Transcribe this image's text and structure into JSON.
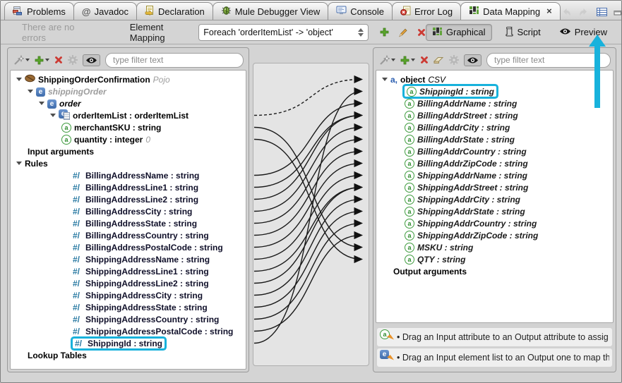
{
  "colors": {
    "accent": "#18b2dc",
    "curve": "#1a1a1a",
    "rule_prefix": "#2879a2"
  },
  "tabs": [
    {
      "label": "Problems",
      "icon": "problems-icon"
    },
    {
      "label": "Javadoc",
      "icon": "at-icon"
    },
    {
      "label": "Declaration",
      "icon": "declaration-icon"
    },
    {
      "label": "Mule Debugger View",
      "icon": "debugger-icon"
    },
    {
      "label": "Console",
      "icon": "console-icon"
    },
    {
      "label": "Error Log",
      "icon": "error-log-icon"
    },
    {
      "label": "Data Mapping",
      "icon": "data-mapping-icon",
      "active": true,
      "close": "×"
    }
  ],
  "window_controls": [
    {
      "name": "nav-back",
      "icon": "nav-back-icon"
    },
    {
      "name": "nav-forward",
      "icon": "nav-forward-icon"
    },
    {
      "name": "view-menu",
      "icon": "view-menu-icon"
    },
    {
      "name": "minimize",
      "icon": "minimize-icon"
    },
    {
      "name": "maximize",
      "icon": "maximize-icon"
    }
  ],
  "toolbar": {
    "status_text": "There are no errors",
    "mapping_label": "Element Mapping",
    "dropdown_value": "Foreach 'orderItemList' -> 'object'",
    "actions": [
      {
        "icon": "add-icon"
      },
      {
        "icon": "pencil-icon"
      },
      {
        "icon": "delete-icon"
      }
    ],
    "view_buttons": [
      {
        "label": "Graphical",
        "icon": "data-mapping-icon",
        "active": true
      },
      {
        "label": "Script",
        "icon": "script-icon",
        "active": false
      },
      {
        "label": "Preview",
        "icon": "eye-icon",
        "active": false
      }
    ]
  },
  "left_panel": {
    "filter_placeholder": "type filter text",
    "toolbar": [
      {
        "icon": "wand-icon",
        "dropdown": true
      },
      {
        "icon": "add-icon",
        "dropdown": true
      },
      {
        "icon": "delete-icon"
      },
      {
        "icon": "gear-icon"
      },
      {
        "icon": "eye-icon",
        "pressed": true
      }
    ],
    "tree": [
      {
        "id": "ShippingOrderConfirmation",
        "label": "ShippingOrderConfirmation",
        "suffix": " Pojo",
        "icon": "bean-icon",
        "level": 0,
        "arrow": true,
        "label_style": "t-bold",
        "suffix_style": "t-grayit"
      },
      {
        "id": "shippingOrder",
        "label": "shippingOrder",
        "icon": "element-icon",
        "level": 1,
        "arrow": true,
        "label_style": "t-gray"
      },
      {
        "id": "order",
        "label": "order",
        "icon": "element-icon",
        "level": 2,
        "arrow": true,
        "label_style": "t-bolditalic"
      },
      {
        "id": "orderItemList",
        "label": "orderItemList : orderItemList",
        "icon": "element-list-icon",
        "level": 3,
        "arrow": true,
        "label_style": "t-bold"
      },
      {
        "id": "merchantSKU",
        "label": "merchantSKU : string",
        "icon": "attribute-icon",
        "level": 4,
        "label_style": "t-bold"
      },
      {
        "id": "quantity",
        "label": "quantity : integer",
        "suffix": " 0",
        "icon": "attribute-icon",
        "level": 4,
        "label_style": "t-bold",
        "suffix_style": "t-grayit"
      },
      {
        "id": "input-arguments",
        "label": "Input arguments",
        "level": 1,
        "label_style": "t-bold"
      },
      {
        "id": "rules",
        "label": "Rules",
        "level": 0,
        "arrow": true,
        "label_style": "t-bold"
      },
      {
        "id": "rule-BillingAddressName",
        "prefix": "#/",
        "label": "BillingAddressName : string",
        "level": 5,
        "label_style": "rule-label"
      },
      {
        "id": "rule-BillingAddressLine1",
        "prefix": "#/",
        "label": "BillingAddressLine1 : string",
        "level": 5,
        "label_style": "rule-label"
      },
      {
        "id": "rule-BillingAddressLine2",
        "prefix": "#/",
        "label": "BillingAddressLine2 : string",
        "level": 5,
        "label_style": "rule-label"
      },
      {
        "id": "rule-BillingAddressCity",
        "prefix": "#/",
        "label": "BillingAddressCity : string",
        "level": 5,
        "label_style": "rule-label"
      },
      {
        "id": "rule-BillingAddressState",
        "prefix": "#/",
        "label": "BillingAddressState : string",
        "level": 5,
        "label_style": "rule-label"
      },
      {
        "id": "rule-BillingAddressCountry",
        "prefix": "#/",
        "label": "BillingAddressCountry : string",
        "level": 5,
        "label_style": "rule-label"
      },
      {
        "id": "rule-BillingAddressPostalCode",
        "prefix": "#/",
        "label": "BillingAddressPostalCode : string",
        "level": 5,
        "label_style": "rule-label"
      },
      {
        "id": "rule-ShippingAddressName",
        "prefix": "#/",
        "label": "ShippingAddressName : string",
        "level": 5,
        "label_style": "rule-label"
      },
      {
        "id": "rule-ShippingAddressLine1",
        "prefix": "#/",
        "label": "ShippingAddressLine1 : string",
        "level": 5,
        "label_style": "rule-label"
      },
      {
        "id": "rule-ShippingAddressLine2",
        "prefix": "#/",
        "label": "ShippingAddressLine2 : string",
        "level": 5,
        "label_style": "rule-label"
      },
      {
        "id": "rule-ShippingAddressCity",
        "prefix": "#/",
        "label": "ShippingAddressCity : string",
        "level": 5,
        "label_style": "rule-label"
      },
      {
        "id": "rule-ShippingAddressState",
        "prefix": "#/",
        "label": "ShippingAddressState : string",
        "level": 5,
        "label_style": "rule-label"
      },
      {
        "id": "rule-ShippingAddressCountry",
        "prefix": "#/",
        "label": "ShippingAddressCountry : string",
        "level": 5,
        "label_style": "rule-label"
      },
      {
        "id": "rule-ShippingAddressPostalCode",
        "prefix": "#/",
        "label": "ShippingAddressPostalCode : string",
        "level": 5,
        "label_style": "rule-label"
      },
      {
        "id": "rule-ShippingId",
        "prefix": "#/",
        "label": "ShippingId : string",
        "level": 5,
        "label_style": "rule-label",
        "highlight": true
      },
      {
        "id": "lookup-tables",
        "label": "Lookup Tables",
        "level": 1,
        "label_style": "t-bold"
      }
    ]
  },
  "right_panel": {
    "filter_placeholder": "type filter text",
    "toolbar": [
      {
        "icon": "wand-icon",
        "dropdown": true
      },
      {
        "icon": "add-icon",
        "dropdown": true
      },
      {
        "icon": "delete-icon"
      },
      {
        "icon": "eraser-icon"
      },
      {
        "icon": "gear-icon"
      },
      {
        "icon": "eye-icon",
        "pressed": true
      }
    ],
    "tree": [
      {
        "id": "object",
        "label": "object",
        "suffix": " CSV",
        "icon": "csv-icon",
        "level": 0,
        "arrow": true,
        "label_style": "t-bold",
        "suffix_style": "t-italic"
      },
      {
        "id": "ShippingId",
        "label": "ShippingId : string",
        "icon": "attribute-icon",
        "level": 2,
        "label_style": "t-attr",
        "highlight": true
      },
      {
        "id": "BillingAddrName",
        "label": "BillingAddrName : string",
        "icon": "attribute-icon",
        "level": 2,
        "label_style": "t-attr"
      },
      {
        "id": "BillingAddrStreet",
        "label": "BillingAddrStreet : string",
        "icon": "attribute-icon",
        "level": 2,
        "label_style": "t-attr"
      },
      {
        "id": "BillingAddrCity",
        "label": "BillingAddrCity : string",
        "icon": "attribute-icon",
        "level": 2,
        "label_style": "t-attr"
      },
      {
        "id": "BillingAddrState",
        "label": "BillingAddrState : string",
        "icon": "attribute-icon",
        "level": 2,
        "label_style": "t-attr"
      },
      {
        "id": "BillingAddrCountry",
        "label": "BillingAddrCountry : string",
        "icon": "attribute-icon",
        "level": 2,
        "label_style": "t-attr"
      },
      {
        "id": "BillingAddrZipCode",
        "label": "BillingAddrZipCode : string",
        "icon": "attribute-icon",
        "level": 2,
        "label_style": "t-attr"
      },
      {
        "id": "ShippingAddrName",
        "label": "ShippingAddrName : string",
        "icon": "attribute-icon",
        "level": 2,
        "label_style": "t-attr"
      },
      {
        "id": "ShippingAddrStreet",
        "label": "ShippingAddrStreet : string",
        "icon": "attribute-icon",
        "level": 2,
        "label_style": "t-attr"
      },
      {
        "id": "ShippingAddrCity",
        "label": "ShippingAddrCity : string",
        "icon": "attribute-icon",
        "level": 2,
        "label_style": "t-attr"
      },
      {
        "id": "ShippingAddrState",
        "label": "ShippingAddrState : string",
        "icon": "attribute-icon",
        "level": 2,
        "label_style": "t-attr"
      },
      {
        "id": "ShippingAddrCountry",
        "label": "ShippingAddrCountry : string",
        "icon": "attribute-icon",
        "level": 2,
        "label_style": "t-attr"
      },
      {
        "id": "ShippingAddrZipCode",
        "label": "ShippingAddrZipCode : string",
        "icon": "attribute-icon",
        "level": 2,
        "label_style": "t-attr"
      },
      {
        "id": "MSKU",
        "label": "MSKU : string",
        "icon": "attribute-icon",
        "level": 2,
        "label_style": "t-attr"
      },
      {
        "id": "QTY",
        "label": "QTY : string",
        "icon": "attribute-icon",
        "level": 2,
        "label_style": "t-attr"
      },
      {
        "id": "output-arguments",
        "label": "Output arguments",
        "level": 1,
        "label_style": "t-bold"
      }
    ],
    "hints": [
      {
        "icon": "attribute-drag-icon",
        "text": "• Drag an Input attribute to an Output attribute to assig"
      },
      {
        "icon": "element-drag-icon",
        "text": "• Drag an Input element list to an Output one to map th"
      }
    ]
  },
  "canvas": {
    "connections": [
      {
        "from": "orderItemList",
        "to": "object",
        "dashed": true
      },
      {
        "from": "merchantSKU",
        "to": "MSKU"
      },
      {
        "from": "quantity",
        "to": "QTY"
      },
      {
        "from": "rule-BillingAddressName",
        "to": "BillingAddrName"
      },
      {
        "from": "rule-BillingAddressLine1",
        "to": "BillingAddrStreet"
      },
      {
        "from": "rule-BillingAddressLine2",
        "to": "BillingAddrStreet"
      },
      {
        "from": "rule-BillingAddressCity",
        "to": "BillingAddrCity"
      },
      {
        "from": "rule-BillingAddressState",
        "to": "BillingAddrState"
      },
      {
        "from": "rule-BillingAddressCountry",
        "to": "BillingAddrCountry"
      },
      {
        "from": "rule-BillingAddressPostalCode",
        "to": "BillingAddrZipCode"
      },
      {
        "from": "rule-ShippingAddressName",
        "to": "ShippingAddrName"
      },
      {
        "from": "rule-ShippingAddressLine1",
        "to": "ShippingAddrStreet"
      },
      {
        "from": "rule-ShippingAddressLine2",
        "to": "ShippingAddrStreet"
      },
      {
        "from": "rule-ShippingAddressCity",
        "to": "ShippingAddrCity"
      },
      {
        "from": "rule-ShippingAddressState",
        "to": "ShippingAddrState"
      },
      {
        "from": "rule-ShippingAddressCountry",
        "to": "ShippingAddrCountry"
      },
      {
        "from": "rule-ShippingAddressPostalCode",
        "to": "ShippingAddrZipCode"
      },
      {
        "from": "rule-ShippingId",
        "to": "ShippingId"
      }
    ]
  }
}
